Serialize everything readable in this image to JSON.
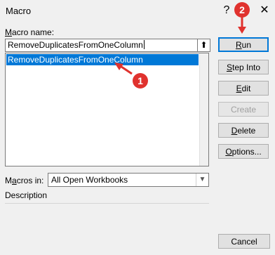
{
  "window": {
    "title": "Macro",
    "help_label": "?",
    "close_label": "✕"
  },
  "macro_name": {
    "label_prefix": "",
    "label_accel": "M",
    "label_rest": "acro name:",
    "value": "RemoveDuplicatesFromOneColumn",
    "up_button": "⬆"
  },
  "macro_list": {
    "items": [
      "RemoveDuplicatesFromOneColumn"
    ]
  },
  "buttons": {
    "run": {
      "accel": "R",
      "rest": "un"
    },
    "step_into": {
      "accel": "S",
      "rest": "tep Into"
    },
    "edit": {
      "accel": "E",
      "rest": "dit"
    },
    "create": {
      "accel": "",
      "rest": "Create"
    },
    "delete": {
      "accel": "D",
      "rest": "elete"
    },
    "options": {
      "accel": "O",
      "rest": "ptions..."
    },
    "cancel": "Cancel"
  },
  "macros_in": {
    "label_prefix": "M",
    "label_accel": "a",
    "label_rest": "cros in:",
    "value": "All Open Workbooks"
  },
  "description": {
    "label": "Description"
  },
  "annotations": {
    "step1": "1",
    "step2": "2"
  },
  "colors": {
    "accent": "#0078d7",
    "annotation": "#e0322e"
  }
}
